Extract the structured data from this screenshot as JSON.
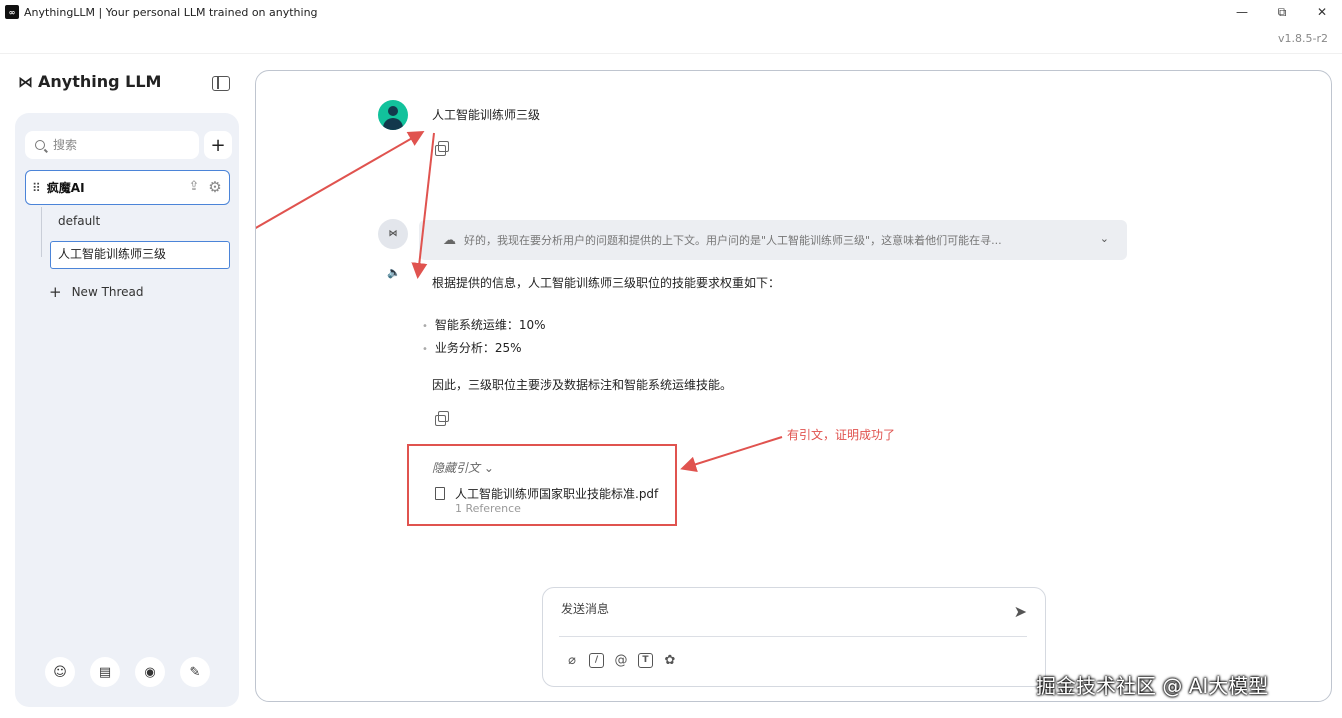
{
  "window": {
    "title": "AnythingLLM | Your personal LLM trained on anything",
    "app_icon": "anythingllm-logo",
    "minimize": "—",
    "maximize": "⧉",
    "close": "✕",
    "version": "v1.8.5-r2"
  },
  "brand": {
    "mark": "⋈",
    "name": "Anything LLM"
  },
  "sidebar": {
    "search_placeholder": "搜索",
    "add_label": "+",
    "workspace": {
      "name": "疯魔AI",
      "drag_handle": "⠿",
      "upload_icon": "⇪",
      "gear_icon": "⚙"
    },
    "threads": [
      {
        "label": "default"
      },
      {
        "label": "人工智能训练师三级"
      }
    ],
    "new_thread": {
      "plus": "+",
      "label": "New Thread"
    },
    "footer": [
      {
        "icon": "community-hub-icon",
        "glyph": "☺"
      },
      {
        "icon": "docs-book-icon",
        "glyph": "▤"
      },
      {
        "icon": "discord-icon",
        "glyph": "◉"
      },
      {
        "icon": "settings-wrench-icon",
        "glyph": "✎"
      }
    ]
  },
  "chat": {
    "user_message": "人工智能训练师三级",
    "bot_avatar": "⋈",
    "speaker_icon": "🔈",
    "thinking": {
      "brain": "☁",
      "text": "好的，我现在要分析用户的问题和提供的上下文。用户问的是\"人工智能训练师三级\"，这意味着他们可能在寻...",
      "chevron": "⌄"
    },
    "answer_intro": "根据提供的信息，人工智能训练师三级职位的技能要求权重如下：",
    "bullets": [
      "智能系统运维：10%",
      "业务分析：25%"
    ],
    "conclusion": "因此，三级职位主要涉及数据标注和智能系统运维技能。",
    "citations": {
      "toggle": "隐藏引文 ⌄",
      "file_name": "人工智能训练师国家职业技能标准.pdf",
      "count": "1 Reference"
    },
    "annotation": "有引文，证明成功了"
  },
  "composer": {
    "placeholder": "发送消息",
    "send_glyph": "➤",
    "tools": [
      {
        "icon": "attachment-icon",
        "glyph": "⌀"
      },
      {
        "icon": "slash-command-icon",
        "glyph": "/"
      },
      {
        "icon": "mention-agent-icon",
        "glyph": "@"
      },
      {
        "icon": "text-size-icon",
        "glyph": "T"
      },
      {
        "icon": "brain-icon",
        "glyph": "✿"
      }
    ]
  },
  "watermark": "掘金技术社区 @ AI大模型",
  "colors": {
    "accent_blue": "#4b84d8",
    "annotation_red": "#e0534f",
    "avatar_teal": "#12c29c",
    "sidebar_bg": "#eef1f7"
  }
}
